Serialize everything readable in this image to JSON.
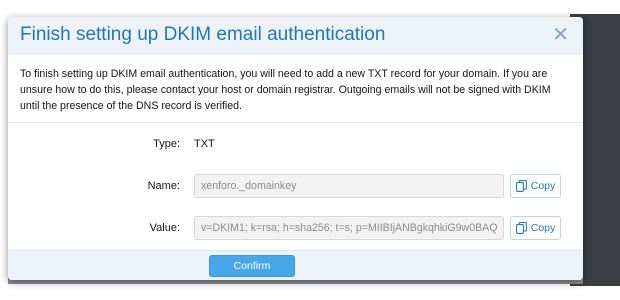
{
  "dialog": {
    "title": "Finish setting up DKIM email authentication",
    "close_icon": "close-icon",
    "intro": "To finish setting up DKIM email authentication, you will need to add a new TXT record for your domain. If you are unsure how to do this, please contact your host or domain registrar. Outgoing emails will not be signed with DKIM until the presence of the DNS record is verified."
  },
  "fields": {
    "type": {
      "label": "Type:",
      "value": "TXT"
    },
    "name": {
      "label": "Name:",
      "value": "xenforo._domainkey",
      "copy_label": "Copy"
    },
    "value": {
      "label": "Value:",
      "value": "v=DKIM1; k=rsa; h=sha256; t=s; p=MIIBIjANBgkqhkiG9w0BAQ",
      "copy_label": "Copy"
    }
  },
  "footer": {
    "confirm_label": "Confirm"
  },
  "colors": {
    "accent": "#2577b1",
    "header_bg": "#edf2f8",
    "button_bg": "#47a7eb"
  }
}
